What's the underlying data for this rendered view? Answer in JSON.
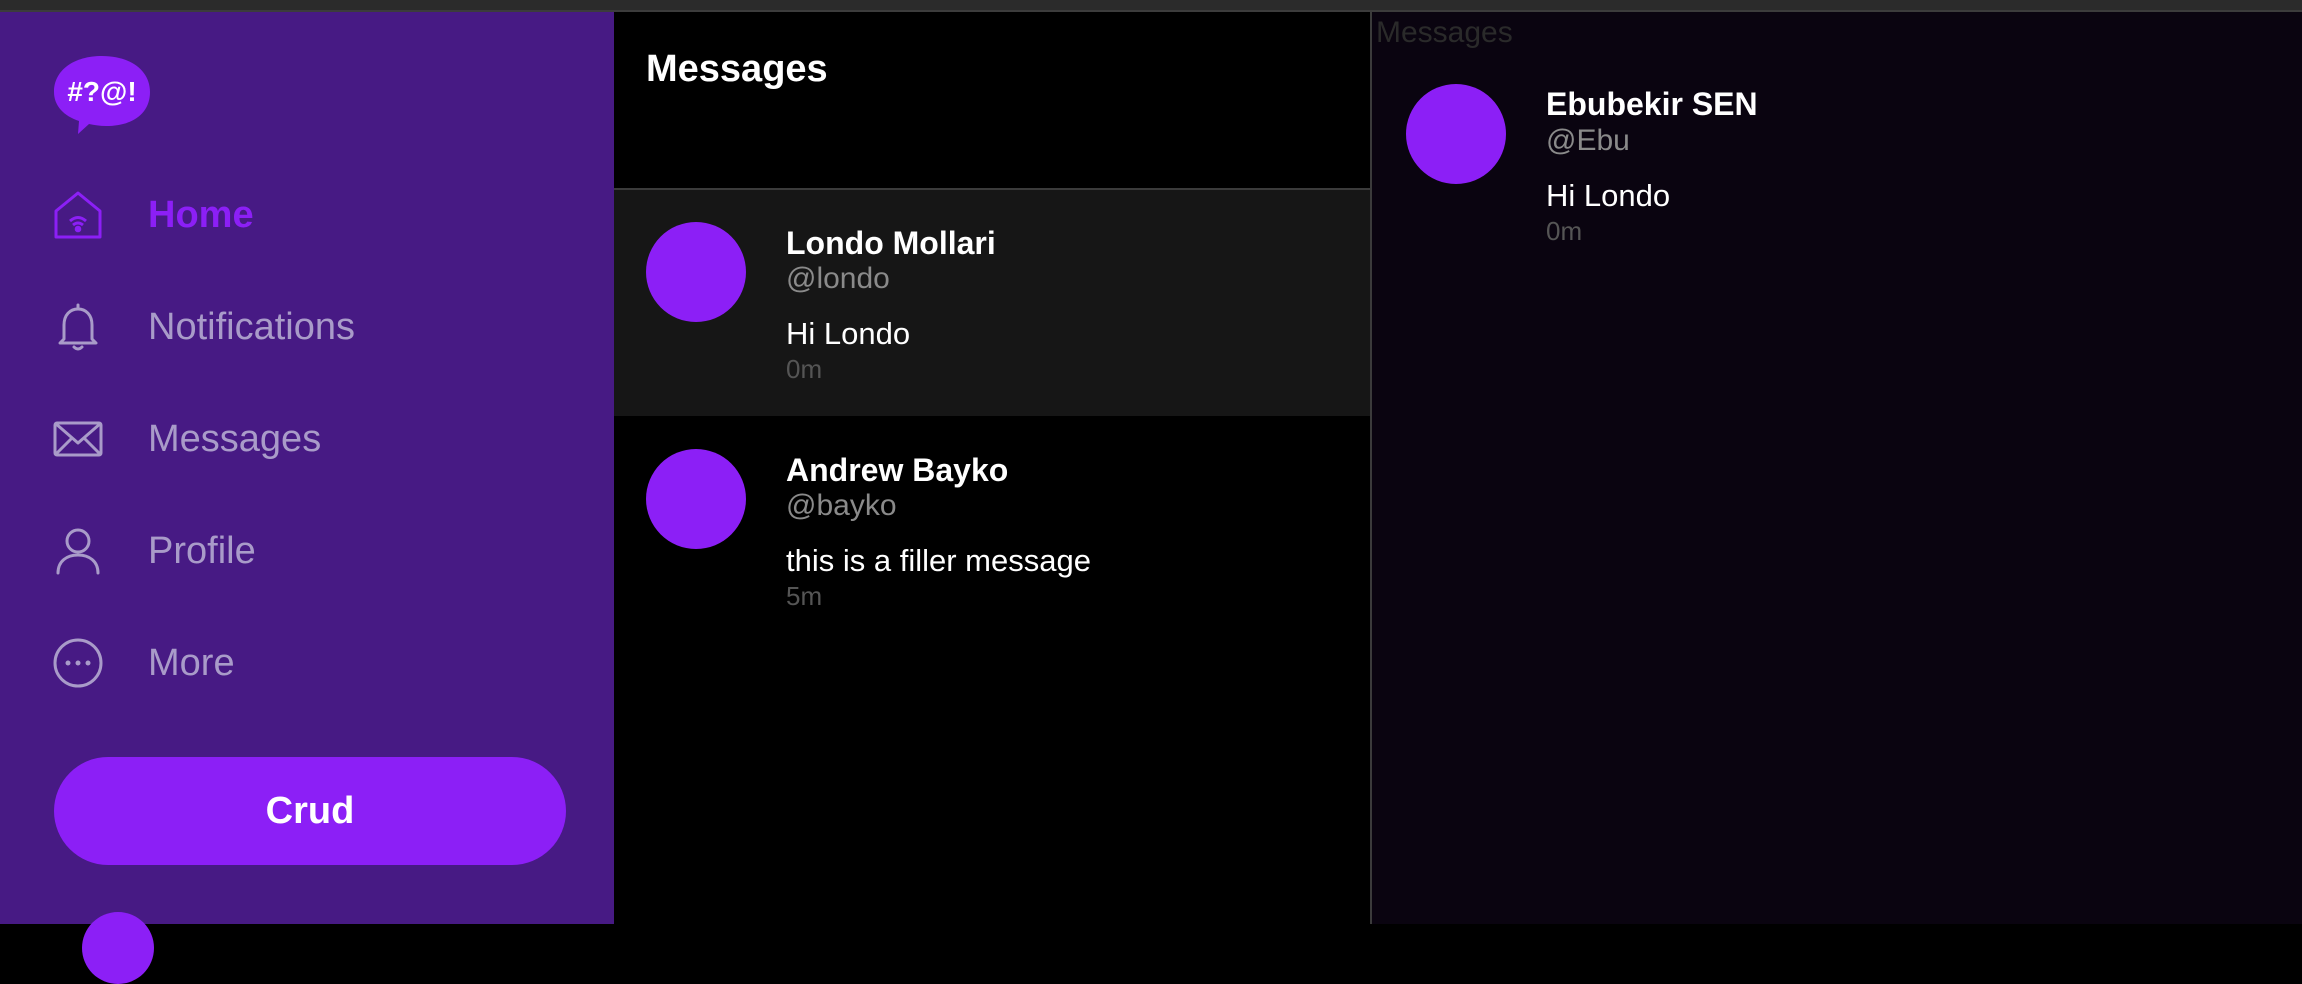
{
  "logo": {
    "text": "#?@!"
  },
  "sidebar": {
    "items": [
      {
        "label": "Home",
        "icon": "home-icon",
        "active": true
      },
      {
        "label": "Notifications",
        "icon": "bell-icon",
        "active": false
      },
      {
        "label": "Messages",
        "icon": "envelope-icon",
        "active": false
      },
      {
        "label": "Profile",
        "icon": "user-icon",
        "active": false
      },
      {
        "label": "More",
        "icon": "more-icon",
        "active": false
      }
    ],
    "button_label": "Crud"
  },
  "middle": {
    "title": "Messages",
    "messages": [
      {
        "name": "Londo Mollari",
        "handle": "@londo",
        "text": "Hi Londo",
        "time": "0m",
        "selected": true
      },
      {
        "name": "Andrew Bayko",
        "handle": "@bayko",
        "text": "this is a filler message",
        "time": "5m",
        "selected": false
      }
    ]
  },
  "detail": {
    "label": "Messages",
    "message": {
      "name": "Ebubekir SEN",
      "handle": "@Ebu",
      "text": "Hi Londo",
      "time": "0m"
    }
  },
  "colors": {
    "accent": "#8c1ff6",
    "sidebar_bg": "#471a84",
    "nav_text": "#a99bc9",
    "selected_row": "#161616"
  }
}
